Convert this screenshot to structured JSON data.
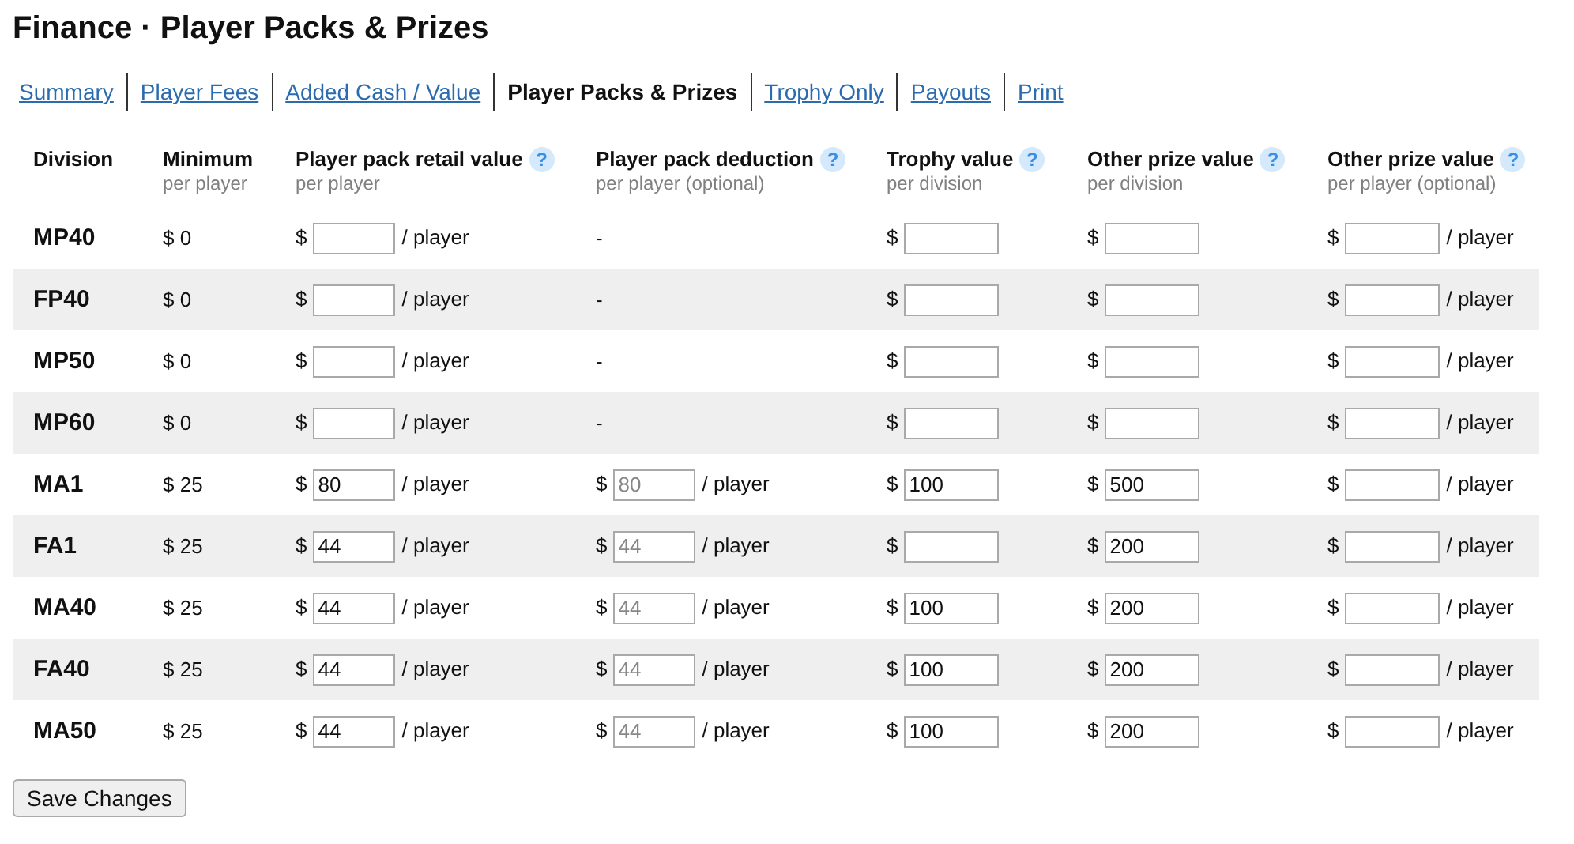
{
  "title": "Finance · Player Packs & Prizes",
  "tabs": [
    {
      "label": "Summary",
      "selected": false
    },
    {
      "label": "Player Fees",
      "selected": false
    },
    {
      "label": "Added Cash / Value",
      "selected": false
    },
    {
      "label": "Player Packs & Prizes",
      "selected": true
    },
    {
      "label": "Trophy Only",
      "selected": false
    },
    {
      "label": "Payouts",
      "selected": false
    },
    {
      "label": "Print",
      "selected": false
    }
  ],
  "columns": [
    {
      "title": "Division",
      "help": false
    },
    {
      "title": "Minimum",
      "subtitle": "per player",
      "help": false
    },
    {
      "title": "Player pack retail value",
      "subtitle": "per player",
      "help": true
    },
    {
      "title": "Player pack deduction",
      "subtitle": "per player (optional)",
      "help": true
    },
    {
      "title": "Trophy value",
      "subtitle": "per division",
      "help": true
    },
    {
      "title": "Other prize value",
      "subtitle": "per division",
      "help": true
    },
    {
      "title": "Other prize value",
      "subtitle": "per player (optional)",
      "help": true
    }
  ],
  "help_mark": "?",
  "rows": [
    {
      "division": "MP40",
      "minimum": "$ 0",
      "cells": [
        {
          "kind": "input",
          "prefix": "$",
          "unit": "/ player"
        },
        {
          "kind": "text",
          "text": "-"
        },
        {
          "kind": "input",
          "prefix": "$"
        },
        {
          "kind": "input",
          "prefix": "$"
        },
        {
          "kind": "input",
          "prefix": "$",
          "unit": "/ player"
        }
      ]
    },
    {
      "division": "FP40",
      "minimum": "$ 0",
      "cells": [
        {
          "kind": "input",
          "prefix": "$",
          "unit": "/ player"
        },
        {
          "kind": "text",
          "text": "-"
        },
        {
          "kind": "input",
          "prefix": "$"
        },
        {
          "kind": "input",
          "prefix": "$"
        },
        {
          "kind": "input",
          "prefix": "$",
          "unit": "/ player"
        }
      ]
    },
    {
      "division": "MP50",
      "minimum": "$ 0",
      "cells": [
        {
          "kind": "input",
          "prefix": "$",
          "unit": "/ player"
        },
        {
          "kind": "text",
          "text": "-"
        },
        {
          "kind": "input",
          "prefix": "$"
        },
        {
          "kind": "input",
          "prefix": "$"
        },
        {
          "kind": "input",
          "prefix": "$",
          "unit": "/ player"
        }
      ]
    },
    {
      "division": "MP60",
      "minimum": "$ 0",
      "cells": [
        {
          "kind": "input",
          "prefix": "$",
          "unit": "/ player"
        },
        {
          "kind": "text",
          "text": "-"
        },
        {
          "kind": "input",
          "prefix": "$"
        },
        {
          "kind": "input",
          "prefix": "$"
        },
        {
          "kind": "input",
          "prefix": "$",
          "unit": "/ player"
        }
      ]
    },
    {
      "division": "MA1",
      "minimum": "$ 25",
      "cells": [
        {
          "kind": "input",
          "prefix": "$",
          "value": "80",
          "unit": "/ player"
        },
        {
          "kind": "input",
          "prefix": "$",
          "placeholder": "80",
          "unit": "/ player"
        },
        {
          "kind": "input",
          "prefix": "$",
          "value": "100"
        },
        {
          "kind": "input",
          "prefix": "$",
          "value": "500"
        },
        {
          "kind": "input",
          "prefix": "$",
          "unit": "/ player"
        }
      ]
    },
    {
      "division": "FA1",
      "minimum": "$ 25",
      "cells": [
        {
          "kind": "input",
          "prefix": "$",
          "value": "44",
          "unit": "/ player"
        },
        {
          "kind": "input",
          "prefix": "$",
          "placeholder": "44",
          "unit": "/ player"
        },
        {
          "kind": "input",
          "prefix": "$"
        },
        {
          "kind": "input",
          "prefix": "$",
          "value": "200"
        },
        {
          "kind": "input",
          "prefix": "$",
          "unit": "/ player"
        }
      ]
    },
    {
      "division": "MA40",
      "minimum": "$ 25",
      "cells": [
        {
          "kind": "input",
          "prefix": "$",
          "value": "44",
          "unit": "/ player"
        },
        {
          "kind": "input",
          "prefix": "$",
          "placeholder": "44",
          "unit": "/ player"
        },
        {
          "kind": "input",
          "prefix": "$",
          "value": "100"
        },
        {
          "kind": "input",
          "prefix": "$",
          "value": "200"
        },
        {
          "kind": "input",
          "prefix": "$",
          "unit": "/ player"
        }
      ]
    },
    {
      "division": "FA40",
      "minimum": "$ 25",
      "cells": [
        {
          "kind": "input",
          "prefix": "$",
          "value": "44",
          "unit": "/ player"
        },
        {
          "kind": "input",
          "prefix": "$",
          "placeholder": "44",
          "unit": "/ player"
        },
        {
          "kind": "input",
          "prefix": "$",
          "value": "100"
        },
        {
          "kind": "input",
          "prefix": "$",
          "value": "200"
        },
        {
          "kind": "input",
          "prefix": "$",
          "unit": "/ player"
        }
      ]
    },
    {
      "division": "MA50",
      "minimum": "$ 25",
      "cells": [
        {
          "kind": "input",
          "prefix": "$",
          "value": "44",
          "unit": "/ player"
        },
        {
          "kind": "input",
          "prefix": "$",
          "placeholder": "44",
          "unit": "/ player"
        },
        {
          "kind": "input",
          "prefix": "$",
          "value": "100"
        },
        {
          "kind": "input",
          "prefix": "$",
          "value": "200"
        },
        {
          "kind": "input",
          "prefix": "$",
          "unit": "/ player"
        }
      ]
    }
  ],
  "save_button": "Save Changes"
}
